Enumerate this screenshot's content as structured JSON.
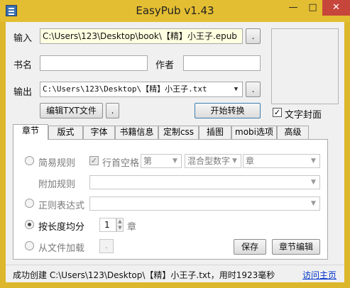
{
  "window": {
    "title": "EasyPub v1.43",
    "controls": {
      "minimize": "—",
      "maximize": "□",
      "close": "✕"
    }
  },
  "form": {
    "input_label": "输入",
    "input_value": "C:\\Users\\123\\Desktop\\book\\【精】小王子.epub",
    "browse_input": ".",
    "title_label": "书名",
    "title_value": "",
    "author_label": "作者",
    "author_value": "",
    "output_label": "输出",
    "output_value": "C:\\Users\\123\\Desktop\\【精】小王子.txt",
    "browse_output": ".",
    "edit_txt_button": "编辑TXT文件",
    "edit_dot_button": ".",
    "start_button": "开始转换",
    "text_cover_label": "文字封面",
    "text_cover_checked": "✓"
  },
  "tabs": [
    "章节",
    "版式",
    "字体",
    "书籍信息",
    "定制css",
    "插图",
    "mobi选项",
    "高级"
  ],
  "chapter_panel": {
    "simple_rule_label": "简易规则",
    "indent_check": "✓",
    "indent_label": "行首空格",
    "combo_di": "第",
    "combo_number_type": "混合型数字",
    "combo_zhang": "章",
    "extra_rule_label": "附加规则",
    "regex_label": "正则表达式",
    "by_length_label": "按长度均分",
    "length_value": "1",
    "length_unit": "章",
    "from_file_label": "从文件加载",
    "from_file_dot": ".",
    "save_button": "保存",
    "chapter_edit_button": "章节编辑"
  },
  "status": {
    "message": "成功创建 C:\\Users\\123\\Desktop\\【精】小王子.txt，用时1923毫秒",
    "homepage_link": "访问主页"
  },
  "colors": {
    "titlebar": "#e4be32",
    "close_button": "#c7463b",
    "link": "#0033cc",
    "input_highlight": "#ffffe1"
  }
}
